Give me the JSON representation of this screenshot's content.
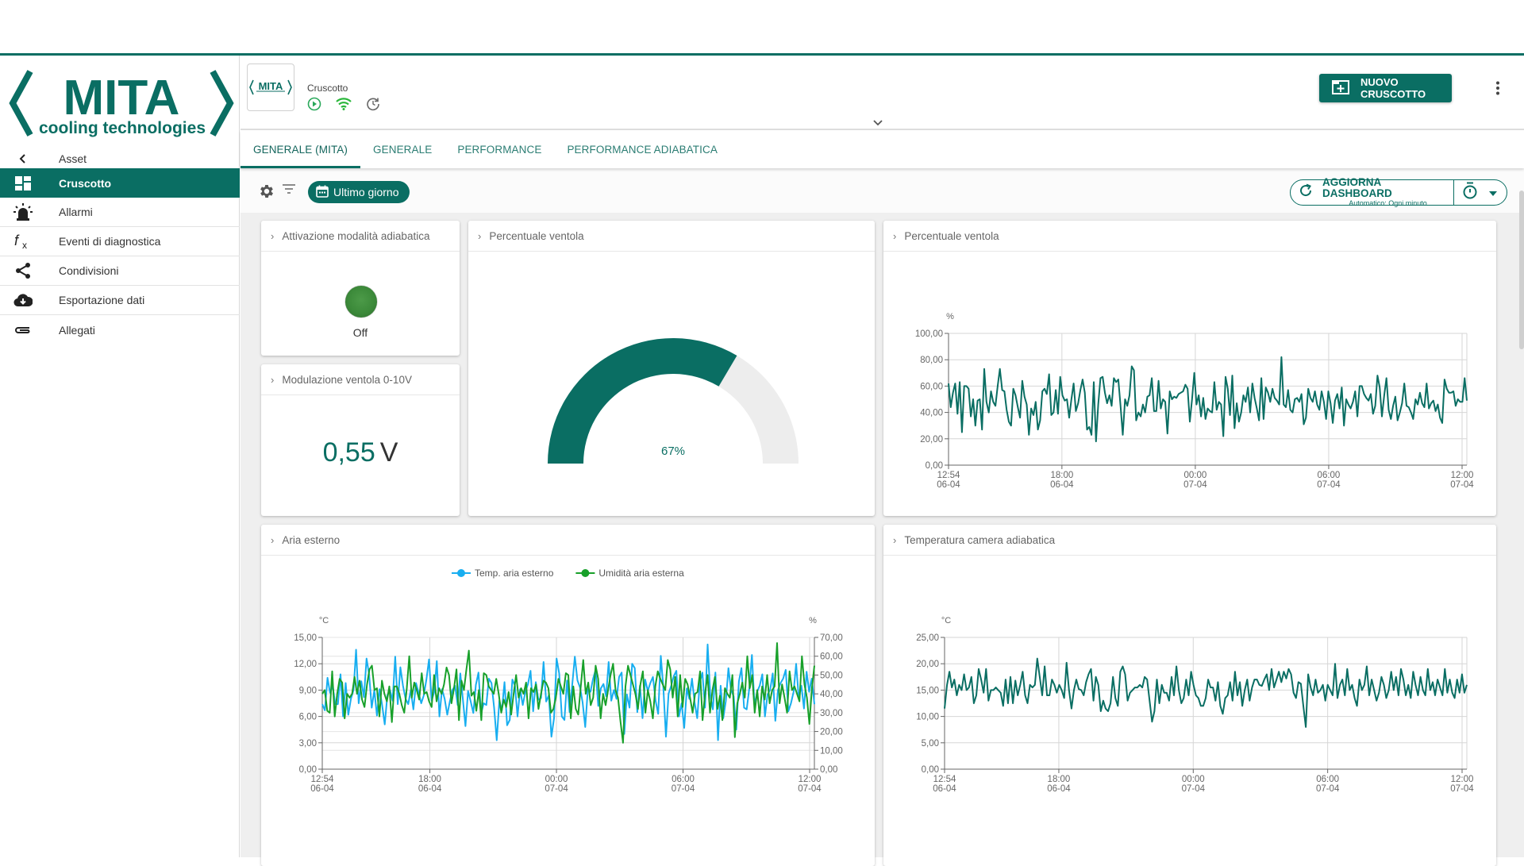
{
  "brand": {
    "name": "MITA",
    "tagline": "cooling technologies",
    "color": "#0a6e63"
  },
  "sidebar": {
    "back_label": "Asset",
    "items": [
      {
        "label": "Cruscotto",
        "icon": "dashboard-icon",
        "active": true
      },
      {
        "label": "Allarmi",
        "icon": "alarm-icon",
        "active": false
      },
      {
        "label": "Eventi di diagnostica",
        "icon": "function-icon",
        "active": false
      },
      {
        "label": "Condivisioni",
        "icon": "share-icon",
        "active": false
      },
      {
        "label": "Esportazione dati",
        "icon": "cloud-download-icon",
        "active": false
      },
      {
        "label": "Allegati",
        "icon": "attachment-icon",
        "active": false
      }
    ]
  },
  "header": {
    "asset_title": "Cruscotto",
    "thumb_label": "MITA",
    "status_icons": [
      "play-circle-icon",
      "wifi-icon",
      "history-icon"
    ],
    "new_dashboard_label": "NUOVO CRUSCOTTO"
  },
  "tabs": [
    {
      "label": "GENERALE (MITA)",
      "active": true
    },
    {
      "label": "GENERALE",
      "active": false
    },
    {
      "label": "PERFORMANCE",
      "active": false
    },
    {
      "label": "PERFORMANCE ADIABATICA",
      "active": false
    }
  ],
  "toolbar": {
    "period_label": "Ultimo giorno",
    "refresh_title": "AGGIORNA DASHBOARD",
    "refresh_subtitle": "Automatico: Ogni minuto"
  },
  "widgets": {
    "adiabatic": {
      "title": "Attivazione modalità adiabatica",
      "state_label": "Off"
    },
    "modulation": {
      "title": "Modulazione ventola 0-10V",
      "value": "0,55",
      "unit": "V"
    },
    "gauge": {
      "title": "Percentuale ventola",
      "value_label": "67%",
      "fraction": 0.67
    },
    "fan_chart": {
      "title": "Percentuale ventola"
    },
    "outside_air": {
      "title": "Aria esterno"
    },
    "chamber_temp": {
      "title": "Temperatura camera adiabatica"
    }
  },
  "chart_data": [
    {
      "id": "fan_pct",
      "type": "line",
      "title": "Percentuale ventola",
      "ylabel": "%",
      "ylim": [
        0,
        100
      ],
      "yticks": [
        "0,00",
        "20,00",
        "40,00",
        "60,00",
        "80,00",
        "100,00"
      ],
      "xticks": [
        [
          "12:54",
          "06-04"
        ],
        [
          "18:00",
          "06-04"
        ],
        [
          "00:00",
          "07-04"
        ],
        [
          "06:00",
          "07-04"
        ],
        [
          "12:00",
          "07-04"
        ]
      ],
      "grid": true,
      "series": [
        {
          "name": "Percentuale ventola",
          "color": "#0a6e63",
          "values": [
            62,
            44,
            55,
            62,
            39,
            63,
            25,
            60,
            60,
            58,
            37,
            50,
            30,
            49,
            50,
            27,
            73,
            48,
            40,
            56,
            48,
            45,
            60,
            73,
            57,
            56,
            42,
            33,
            30,
            58,
            53,
            44,
            36,
            64,
            52,
            46,
            23,
            43,
            38,
            48,
            27,
            34,
            56,
            58,
            54,
            69,
            38,
            40,
            57,
            39,
            67,
            53,
            49,
            50,
            36,
            50,
            62,
            41,
            47,
            57,
            65,
            55,
            27,
            29,
            23,
            63,
            18,
            46,
            66,
            67,
            55,
            47,
            53,
            45,
            66,
            63,
            65,
            45,
            23,
            50,
            45,
            53,
            75,
            72,
            34,
            40,
            37,
            46,
            40,
            52,
            53,
            66,
            41,
            41,
            64,
            43,
            50,
            48,
            24,
            56,
            50,
            52,
            51,
            54,
            55,
            56,
            61,
            58,
            33,
            50,
            70,
            46,
            53,
            37,
            51,
            35,
            43,
            41,
            40,
            63,
            42,
            48,
            46,
            22,
            67,
            58,
            38,
            68,
            28,
            47,
            33,
            40,
            53,
            48,
            59,
            40,
            62,
            51,
            43,
            34,
            66,
            35,
            59,
            55,
            48,
            58,
            51,
            49,
            46,
            82,
            46,
            44,
            57,
            42,
            40,
            50,
            51,
            48,
            54,
            31,
            36,
            58,
            51,
            48,
            56,
            46,
            42,
            56,
            48,
            35,
            56,
            47,
            32,
            49,
            54,
            43,
            59,
            30,
            50,
            46,
            43,
            48,
            56,
            37,
            60,
            60,
            54,
            51,
            49,
            54,
            39,
            45,
            68,
            59,
            37,
            53,
            66,
            42,
            35,
            45,
            52,
            34,
            40,
            47,
            62,
            45,
            44,
            40,
            35,
            50,
            46,
            55,
            47,
            44,
            62,
            43,
            47,
            49,
            41,
            46,
            36,
            32,
            65,
            58,
            55,
            55,
            56,
            45,
            50,
            48,
            48,
            66,
            49
          ]
        }
      ]
    },
    {
      "id": "outside_air",
      "type": "line",
      "title": "Aria esterno",
      "ylabel": "°C",
      "ylabel_right": "%",
      "ylim": [
        0,
        15
      ],
      "ylim_right": [
        0,
        70
      ],
      "yticks": [
        "0,00",
        "3,00",
        "6,00",
        "9,00",
        "12,00",
        "15,00"
      ],
      "yticks_right": [
        "0,00",
        "10,00",
        "20,00",
        "30,00",
        "40,00",
        "50,00",
        "60,00",
        "70,00"
      ],
      "xticks": [
        [
          "12:54",
          "06-04"
        ],
        [
          "18:00",
          "06-04"
        ],
        [
          "00:00",
          "07-04"
        ],
        [
          "06:00",
          "07-04"
        ],
        [
          "12:00",
          "07-04"
        ]
      ],
      "legend": "top-center",
      "grid": true,
      "series": [
        {
          "name": "Temp. aria esterno",
          "axis": "left",
          "color": "#18aef0",
          "values": [
            7.4,
            6.7,
            10.4,
            8.7,
            9.5,
            7.4,
            7.4,
            10.8,
            6.0,
            9.8,
            6.2,
            8.0,
            9.0,
            13.6,
            7.5,
            10.0,
            8.2,
            12.6,
            10.8,
            7.0,
            9.0,
            6.1,
            9.1,
            7.3,
            5.1,
            8.4,
            9.0,
            7.8,
            12.8,
            7.4,
            11.6,
            9.5,
            8.0,
            7.4,
            9.0,
            6.8,
            9.8,
            8.7,
            7.5,
            8.4,
            10.2,
            12.5,
            7.8,
            8.8,
            12.3,
            6.0,
            9.1,
            8.0,
            6.2,
            7.7,
            9.0,
            9.5,
            7.3,
            10.9,
            8.0,
            4.9,
            8.9,
            7.7,
            6.4,
            9.6,
            11.0,
            6.3,
            7.5,
            7.3,
            10.3,
            9.8,
            7.0,
            3.3,
            7.8,
            6.7,
            9.9,
            5.0,
            5.6,
            10.2,
            9.5,
            6.0,
            9.1,
            7.3,
            8.8,
            9.7,
            11.2,
            6.6,
            9.9,
            7.9,
            8.1,
            12.2,
            7.7,
            8.4,
            3.7,
            5.8,
            12.6,
            10.9,
            6.0,
            5.6,
            10.1,
            6.5,
            9.6,
            12.8,
            10.1,
            9.3,
            7.6,
            4.8,
            9.1,
            8.8,
            10.3,
            11.3,
            7.2,
            9.2,
            9.7,
            8.3,
            12.2,
            7.8,
            9.0,
            8.0,
            10.5,
            11.0,
            4.0,
            8.5,
            7.0,
            12.0,
            11.5,
            6.5,
            9.5,
            5.8,
            10.2,
            8.9,
            9.8,
            10.5,
            7.8,
            6.3,
            12.9,
            9.3,
            3.7,
            8.6,
            9.5,
            10.6,
            11.2,
            6.0,
            7.5,
            4.7,
            9.2,
            8.0,
            10.3,
            7.6,
            5.8,
            9.9,
            11.0,
            7.0,
            14.2,
            8.5,
            6.8,
            11.0,
            3.3,
            9.5,
            5.8,
            7.8,
            11.5,
            9.0,
            8.3,
            4.5,
            10.0,
            11.5,
            7.0,
            6.8,
            9.2,
            13.0,
            7.2,
            8.8,
            9.5,
            10.8,
            6.0,
            8.5,
            9.0,
            10.9,
            5.5,
            9.0,
            9.8,
            10.3,
            11.3,
            6.6,
            7.5,
            8.8,
            12.0,
            8.1,
            9.5,
            6.9,
            11.1,
            8.8,
            10.3,
            7.4
          ]
        },
        {
          "name": "Umidità aria esterna",
          "axis": "right",
          "color": "#18a02a",
          "values": [
            40,
            42,
            31,
            30,
            52,
            28,
            40,
            48,
            46,
            27,
            40,
            38,
            40,
            49,
            40,
            47,
            37,
            33,
            45,
            53,
            55,
            42,
            43,
            28,
            47,
            40,
            36,
            44,
            25,
            44,
            44,
            40,
            34,
            30,
            43,
            60,
            38,
            46,
            42,
            37,
            51,
            40,
            41,
            36,
            33,
            50,
            36,
            43,
            40,
            45,
            54,
            50,
            35,
            43,
            53,
            26,
            47,
            42,
            53,
            63,
            39,
            41,
            31,
            42,
            26,
            51,
            50,
            44,
            42,
            40,
            48,
            40,
            30,
            37,
            33,
            41,
            29,
            40,
            50,
            38,
            43,
            40,
            46,
            27,
            43,
            41,
            45,
            32,
            40,
            47,
            46,
            43,
            30,
            32,
            38,
            48,
            44,
            40,
            51,
            50,
            27,
            44,
            32,
            29,
            44,
            58,
            40,
            46,
            34,
            38,
            55,
            48,
            27,
            40,
            34,
            42,
            50,
            56,
            42,
            38,
            25,
            14,
            44,
            55,
            50,
            45,
            40,
            32,
            45,
            52,
            30,
            42,
            36,
            27,
            44,
            52,
            48,
            45,
            42,
            58,
            53,
            38,
            49,
            28,
            50,
            33,
            48,
            45,
            38,
            30,
            40,
            41,
            52,
            26,
            40,
            50,
            30,
            42,
            49,
            32,
            39,
            26,
            43,
            40,
            38,
            50,
            17,
            35,
            40,
            46,
            38,
            60,
            43,
            50,
            30,
            42,
            28,
            44,
            37,
            50,
            35,
            42,
            44,
            67,
            35,
            45,
            38,
            30,
            52,
            42,
            44,
            40,
            36,
            60,
            45,
            38,
            24,
            43,
            55
          ]
        }
      ]
    },
    {
      "id": "chamber_temp",
      "type": "line",
      "title": "Temperatura camera adiabatica",
      "ylabel": "°C",
      "ylim": [
        0,
        25
      ],
      "yticks": [
        "0,00",
        "5,00",
        "10,00",
        "15,00",
        "20,00",
        "25,00"
      ],
      "xticks": [
        [
          "12:54",
          "06-04"
        ],
        [
          "18:00",
          "06-04"
        ],
        [
          "00:00",
          "07-04"
        ],
        [
          "06:00",
          "07-04"
        ],
        [
          "12:00",
          "07-04"
        ]
      ],
      "grid": true,
      "series": [
        {
          "name": "Temperatura camera adiabatica",
          "color": "#0a6e63",
          "values": [
            11.5,
            16,
            18.5,
            15.5,
            17,
            14,
            16,
            15,
            18,
            15,
            15.5,
            17.5,
            12.5,
            14,
            19,
            17,
            14.5,
            19,
            13,
            15,
            15,
            15.5,
            15,
            14.5,
            12,
            17,
            12.5,
            17.5,
            12.5,
            16.8,
            14,
            16,
            18.5,
            14,
            12.5,
            16,
            15.5,
            16,
            21,
            17.5,
            14,
            19.5,
            14,
            14,
            17,
            16,
            14.5,
            16,
            15,
            13.5,
            20.2,
            15,
            11.5,
            15,
            17,
            15.2,
            15,
            14,
            16.5,
            18,
            19,
            13,
            17.5,
            16,
            11,
            13,
            11.5,
            11,
            12.5,
            17.5,
            13.5,
            12,
            18.5,
            19.5,
            18,
            13,
            14.5,
            15,
            15.5,
            15.5,
            16,
            15.5,
            17.5,
            17,
            13,
            9,
            11,
            17,
            12.5,
            16,
            14.5,
            14.5,
            13,
            17.5,
            14,
            19.5,
            15,
            12.5,
            13.5,
            17,
            14,
            18.5,
            16,
            14,
            13.5,
            12,
            12,
            13.5,
            17,
            15.5,
            15.5,
            13,
            16.5,
            12,
            10.5,
            13.5,
            14,
            16.5,
            13,
            18.5,
            14,
            16.5,
            12,
            15,
            17,
            13,
            15.5,
            17,
            17,
            16,
            15.8,
            17,
            18,
            15,
            19,
            15.5,
            17,
            18.5,
            16.5,
            18.5,
            17.2,
            19,
            18,
            14.5,
            13.5,
            16.5,
            16.2,
            12,
            8,
            18,
            15.5,
            14,
            17,
            14.5,
            15,
            16,
            13,
            16,
            15,
            14,
            20,
            13.5,
            16,
            17,
            14,
            19,
            15,
            16,
            13.5,
            12,
            17,
            15,
            16,
            19.5,
            14,
            17,
            15,
            13,
            14.5,
            17.5,
            16,
            13.5,
            15,
            18.5,
            15,
            17.5,
            14,
            19,
            17,
            14,
            16,
            13.5,
            18.5,
            16,
            14,
            17.5,
            15,
            14,
            19,
            15,
            16.5,
            14,
            17,
            15.5,
            14,
            19,
            14.5,
            17,
            14.5,
            13.5,
            17,
            14.5,
            18,
            14.5,
            16
          ]
        }
      ]
    }
  ]
}
